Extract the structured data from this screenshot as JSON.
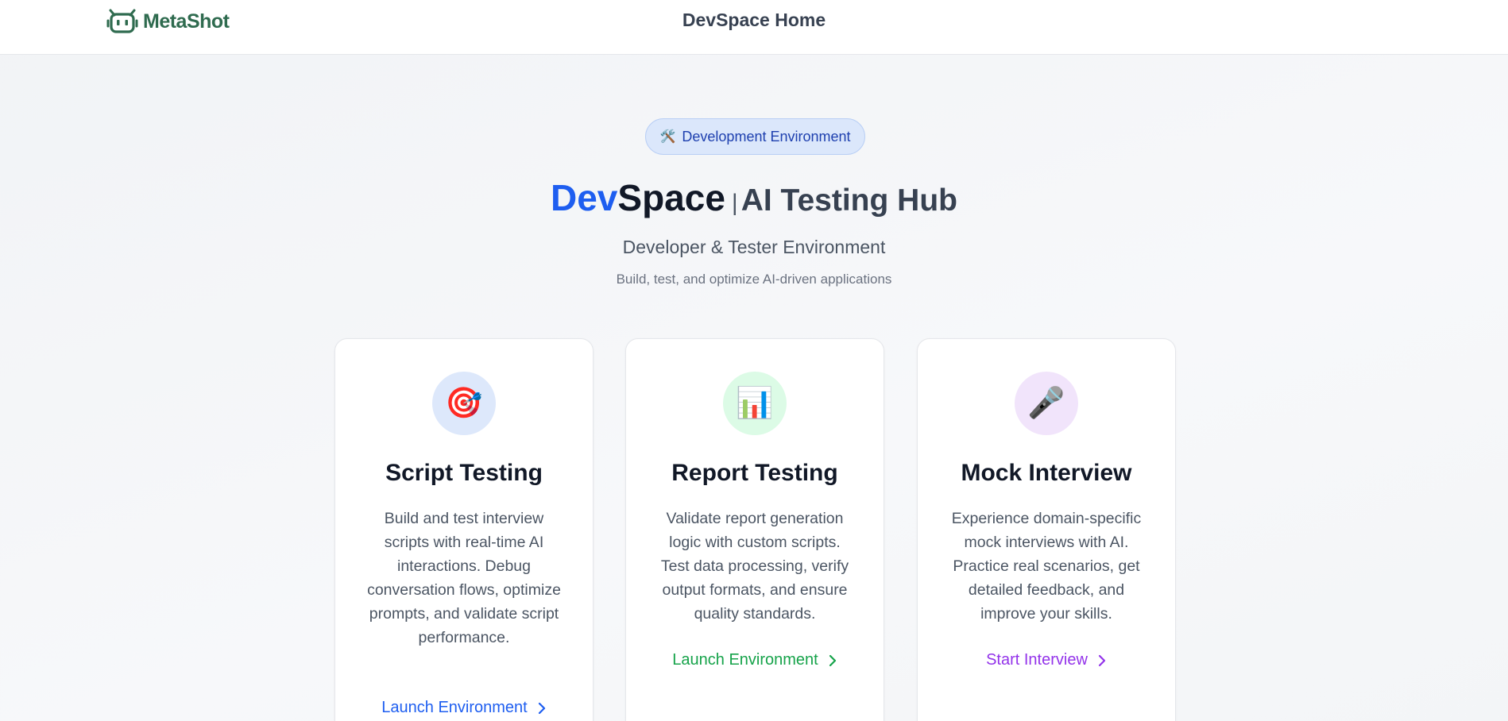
{
  "header": {
    "logo_text": "MetaShot",
    "title": "DevSpace Home"
  },
  "hero": {
    "badge_icon": "🛠️",
    "badge_text": "Development Environment",
    "title_part1": "Dev",
    "title_part2": "Space",
    "title_separator": "|",
    "title_part3": "AI Testing Hub",
    "subtitle": "Developer & Tester Environment",
    "tagline": "Build, test, and optimize AI-driven applications"
  },
  "cards": [
    {
      "icon": "🎯",
      "icon_name": "target-icon",
      "icon_bg": "#dde8fb",
      "title": "Script Testing",
      "description": "Build and test interview scripts with real-time AI interactions. Debug conversation flows, optimize prompts, and validate script performance.",
      "link_label": "Launch Environment",
      "link_color": "#1e5ef0"
    },
    {
      "icon": "📊",
      "icon_name": "bar-chart-icon",
      "icon_bg": "#dcfbe6",
      "title": "Report Testing",
      "description": "Validate report generation logic with custom scripts. Test data processing, verify output formats, and ensure quality standards.",
      "link_label": "Launch Environment",
      "link_color": "#16a34a"
    },
    {
      "icon": "🎤",
      "icon_name": "microphone-icon",
      "icon_bg": "#f1e4fb",
      "title": "Mock Interview",
      "description": "Experience domain-specific mock interviews with AI. Practice real scenarios, get detailed feedback, and improve your skills.",
      "link_label": "Start Interview",
      "link_color": "#9333ea"
    }
  ],
  "colors": {
    "brand_green": "#2f6b4f",
    "accent_blue": "#1e5ef0",
    "accent_green": "#16a34a",
    "accent_purple": "#9333ea"
  }
}
